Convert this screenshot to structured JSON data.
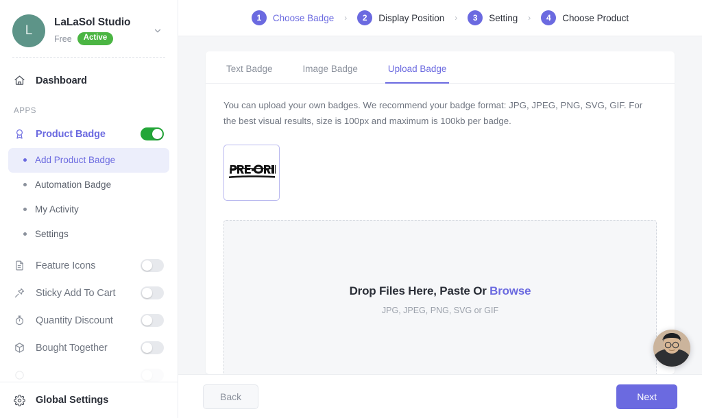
{
  "sidebar": {
    "store": {
      "avatar_initial": "L",
      "name": "LaLaSol Studio",
      "plan": "Free",
      "status": "Active",
      "chevron_icon": "chevron-down-icon"
    },
    "dashboard": {
      "label": "Dashboard",
      "icon": "home-icon"
    },
    "section_label": "APPS",
    "product_badge": {
      "label": "Product Badge",
      "icon": "badge-award-icon",
      "toggle_on": true
    },
    "sub_items": [
      {
        "label": "Add Product Badge",
        "active": true
      },
      {
        "label": "Automation Badge",
        "active": false
      },
      {
        "label": "My Activity",
        "active": false
      },
      {
        "label": "Settings",
        "active": false
      }
    ],
    "apps": [
      {
        "label": "Feature Icons",
        "icon": "document-icon",
        "toggle_on": false
      },
      {
        "label": "Sticky Add To Cart",
        "icon": "pin-icon",
        "toggle_on": false
      },
      {
        "label": "Quantity Discount",
        "icon": "stopwatch-icon",
        "toggle_on": false
      },
      {
        "label": "Bought Together",
        "icon": "package-icon",
        "toggle_on": false
      }
    ],
    "footer": {
      "label": "Global Settings",
      "icon": "gear-icon"
    }
  },
  "stepper": {
    "steps": [
      {
        "num": "1",
        "label": "Choose Badge",
        "current": true
      },
      {
        "num": "2",
        "label": "Display Position",
        "current": false
      },
      {
        "num": "3",
        "label": "Setting",
        "current": false
      },
      {
        "num": "4",
        "label": "Choose Product",
        "current": false
      }
    ],
    "separator": "›"
  },
  "tabs": [
    {
      "label": "Text Badge",
      "active": false
    },
    {
      "label": "Image Badge",
      "active": false
    },
    {
      "label": "Upload Badge",
      "active": true
    }
  ],
  "content": {
    "description": "You can upload your own badges. We recommend your badge format: JPG, JPEG, PNG, SVG, GIF. For the best visual results, size is 100px and maximum is 100kb per badge.",
    "badges": [
      {
        "name": "pre-order-badge",
        "text": "PRE-ORDER",
        "selected": true
      }
    ],
    "dropzone": {
      "title_main": "Drop Files Here, Paste Or",
      "title_link": "Browse",
      "subtitle": "JPG, JPEG, PNG, SVG or GIF"
    }
  },
  "footer": {
    "back_label": "Back",
    "next_label": "Next"
  },
  "chat": {
    "icon": "support-agent-avatar"
  },
  "colors": {
    "accent": "#6b6ae0",
    "accent_soft": "#eceefb",
    "toggle_on": "#23a638",
    "status_active": "#4bb543",
    "avatar_bg": "#5d9488",
    "page_bg": "#f5f6f8"
  }
}
